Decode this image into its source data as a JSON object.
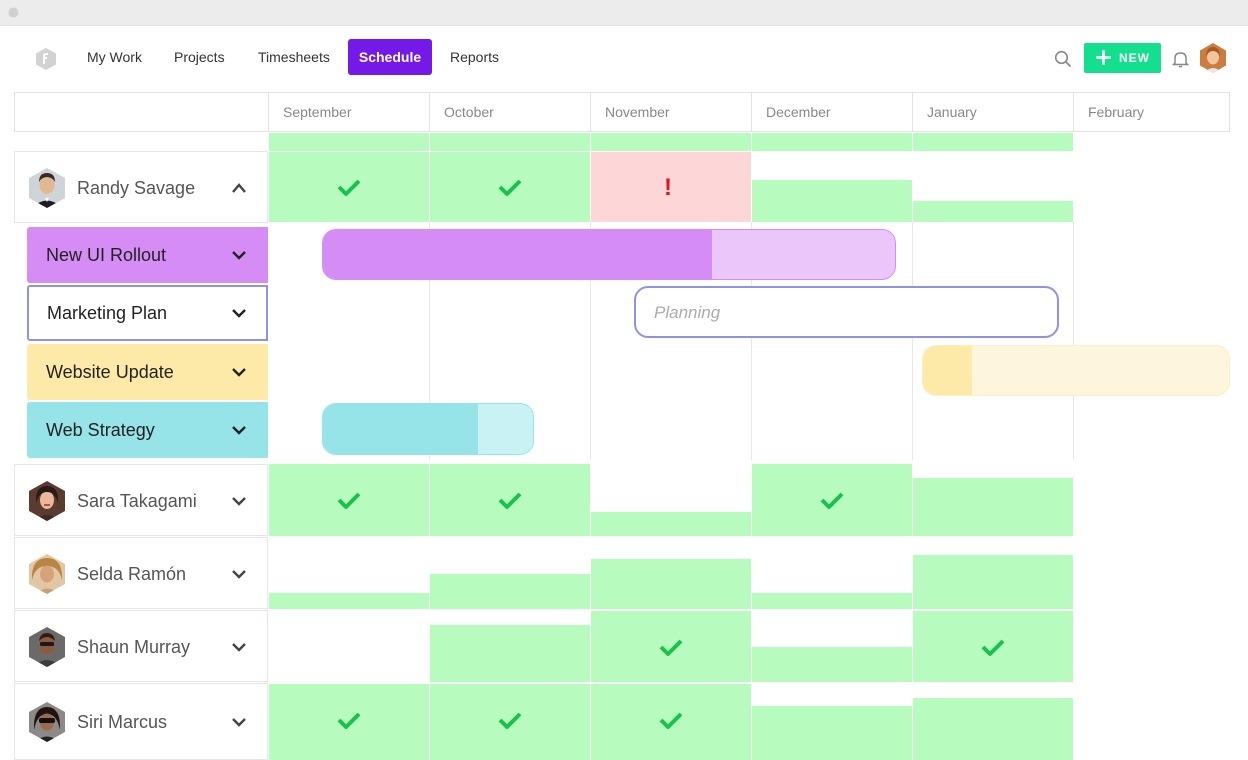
{
  "nav": {
    "items": [
      {
        "label": "My Work"
      },
      {
        "label": "Projects"
      },
      {
        "label": "Timesheets"
      },
      {
        "label": "Schedule"
      },
      {
        "label": "Reports"
      }
    ],
    "active": "Schedule",
    "new_label": "NEW",
    "accent_color": "#7419e8",
    "new_color": "#13df8e"
  },
  "months": [
    "September",
    "October",
    "November",
    "December",
    "January",
    "February"
  ],
  "people": [
    {
      "name": "Randy Savage",
      "expanded": true
    },
    {
      "name": "Sara Takagami"
    },
    {
      "name": "Selda Ramón"
    },
    {
      "name": "Shaun Murray"
    },
    {
      "name": "Siri Marcus"
    }
  ],
  "projects": [
    {
      "name": "New UI Rollout",
      "color": "#d58cf5",
      "progress": 0.68
    },
    {
      "name": "Marketing Plan",
      "status": "Planning",
      "color": "#8f93e6"
    },
    {
      "name": "Website Update",
      "color": "#fdeaa8",
      "progress": 0.16
    },
    {
      "name": "Web Strategy",
      "color": "#97e4e8",
      "progress": 0.74
    }
  ],
  "alerts": {
    "overallocated_symbol": "!"
  },
  "colors": {
    "available": "#b8fbbf",
    "overbooked": "#fdd7d7",
    "check": "#19c24a",
    "alert": "#e0141b"
  }
}
